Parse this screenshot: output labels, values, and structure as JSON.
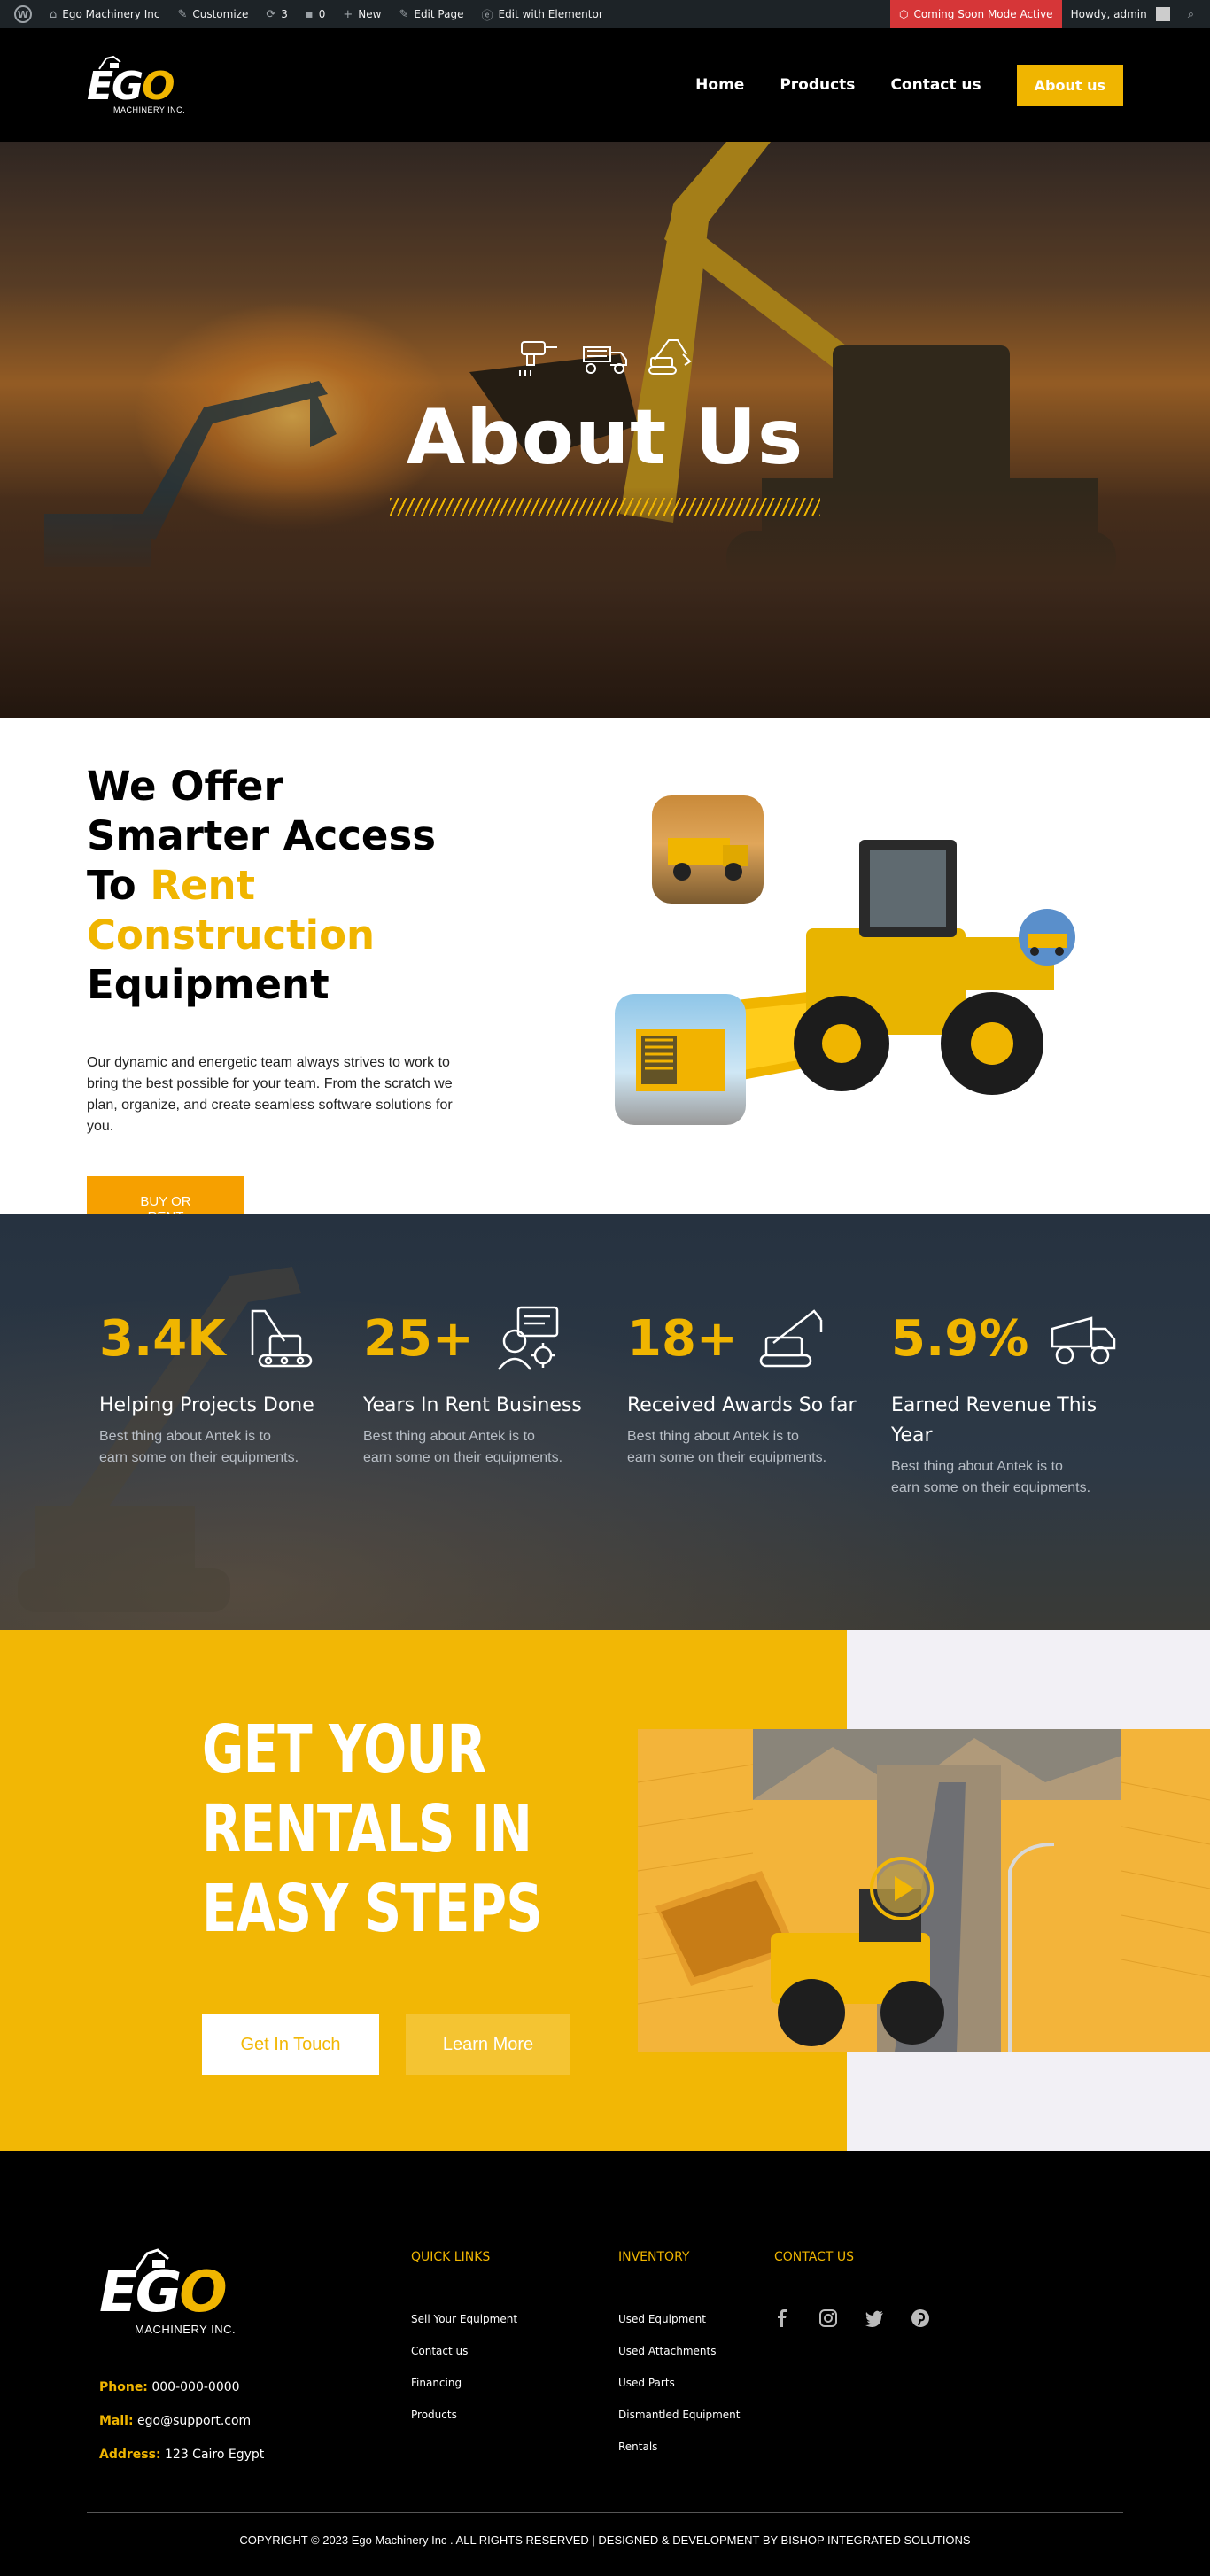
{
  "adminbar": {
    "site_name": "Ego Machinery Inc",
    "customize": "Customize",
    "updates": "3",
    "comments": "0",
    "new": "New",
    "edit_page": "Edit Page",
    "elementor": "Edit with Elementor",
    "coming_soon": "Coming Soon Mode Active",
    "howdy": "Howdy, admin"
  },
  "header": {
    "logo_word_a": "EG",
    "logo_word_b": "O",
    "logo_sub": "MACHINERY INC.",
    "nav": [
      "Home",
      "Products",
      "Contact us",
      "About us"
    ]
  },
  "hero": {
    "title": "About Us"
  },
  "offer": {
    "title_1": "We Offer Smarter Access To ",
    "title_2": "Rent Construction",
    "title_3": " Equipment",
    "desc": "Our dynamic and energetic team always strives to work to bring the best possible for your team. From the scratch we plan, organize, and create seamless software solutions for you.",
    "button": "BUY OR RENT"
  },
  "stats": [
    {
      "num": "3.4K",
      "label": "Helping Projects Done",
      "desc": "Best thing about Antek is to earn some on their equipments."
    },
    {
      "num": "25+",
      "label": "Years In Rent Business",
      "desc": "Best thing about Antek is to earn some on their equipments."
    },
    {
      "num": "18+",
      "label": "Received Awards So far",
      "desc": "Best thing about Antek is to earn some on their equipments."
    },
    {
      "num": "5.9%",
      "label": "Earned Revenue This Year",
      "desc": "Best thing about Antek is to earn some on their equipments."
    }
  ],
  "steps": {
    "title": "GET YOUR RENTALS IN EASY STEPS",
    "btn_primary": "Get In Touch",
    "btn_secondary": "Learn More"
  },
  "footer": {
    "logo_word_a": "EG",
    "logo_word_b": "O",
    "logo_sub": "MACHINERY INC.",
    "phone_label": "Phone:",
    "phone": "000-000-0000",
    "mail_label": "Mail:",
    "mail": "ego@support.com",
    "address_label": "Address:",
    "address": "123 Cairo Egypt",
    "quick_links_title": "QUICK LINKS",
    "quick_links": [
      "Sell Your Equipment",
      "Contact us",
      "Financing",
      "Products"
    ],
    "inventory_title": "INVENTORY",
    "inventory": [
      "Used Equipment",
      "Used Attachments",
      "Used Parts",
      "Dismantled Equipment",
      "Rentals"
    ],
    "contact_title": "CONTACT US",
    "copyright": "COPYRIGHT © 2023 Ego Machinery Inc . ALL RIGHTS RESERVED | DESIGNED & DEVELOPMENT BY BISHOP INTEGRATED SOLUTIONS"
  },
  "colors": {
    "accent": "#f0b500",
    "dark": "#000000",
    "stats_bg": "#26313e",
    "steps_yellow": "#f2b705"
  }
}
